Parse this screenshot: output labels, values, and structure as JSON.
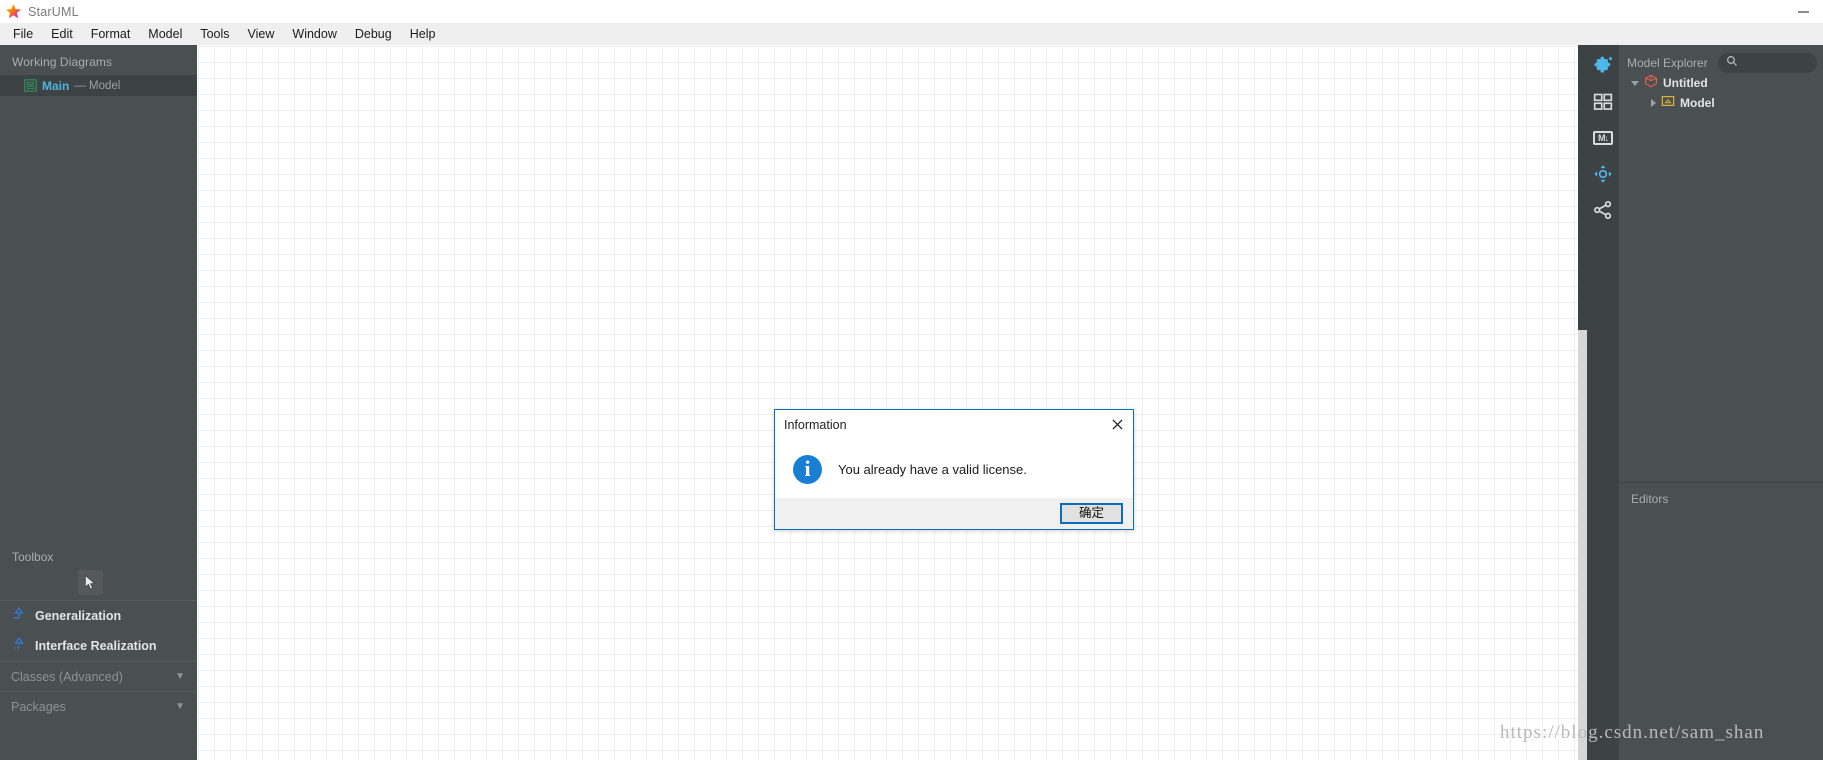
{
  "titlebar": {
    "app_title": "StarUML",
    "logo_icon": "star-icon",
    "minimize_label": "–"
  },
  "menubar": {
    "items": [
      {
        "label": "File"
      },
      {
        "label": "Edit"
      },
      {
        "label": "Format"
      },
      {
        "label": "Model"
      },
      {
        "label": "Tools"
      },
      {
        "label": "View"
      },
      {
        "label": "Window"
      },
      {
        "label": "Debug"
      },
      {
        "label": "Help"
      }
    ]
  },
  "left_panel": {
    "working_diagrams_header": "Working Diagrams",
    "diagram": {
      "icon": "class-diagram-icon",
      "name": "Main",
      "subtitle": "— Model"
    },
    "toolbox_header": "Toolbox",
    "cursor_tool": "cursor-tool",
    "tools": [
      {
        "label": "Generalization",
        "icon": "generalization-arrow-icon"
      },
      {
        "label": "Interface Realization",
        "icon": "interface-realization-icon"
      }
    ],
    "sections": [
      {
        "label": "Classes (Advanced)",
        "caret": "▼"
      },
      {
        "label": "Packages",
        "caret": "▼"
      }
    ]
  },
  "icon_strip": {
    "icons": [
      {
        "name": "extension-puzzle-icon"
      },
      {
        "name": "grid-layout-icon"
      },
      {
        "name": "markdown-icon",
        "glyph": "M↓"
      },
      {
        "name": "move-crosshair-icon"
      },
      {
        "name": "share-nodes-icon"
      }
    ]
  },
  "right_panel": {
    "model_explorer_title": "Model Explorer",
    "search": {
      "icon": "search-icon",
      "value": "",
      "placeholder": ""
    },
    "tree": [
      {
        "label": "Untitled",
        "icon": "project-cube-icon",
        "expander": "triangle-down",
        "level": 1
      },
      {
        "label": "Model",
        "icon": "model-folder-icon",
        "expander": "triangle-right",
        "level": 2
      }
    ],
    "editors_header": "Editors"
  },
  "dialog": {
    "title": "Information",
    "close_icon": "close-icon",
    "info_icon": "info-icon",
    "message": "You already have a valid license.",
    "ok_label": "确定"
  },
  "watermark": {
    "text": "https://blog.csdn.net/sam_shan"
  },
  "colors": {
    "panel_bg": "#4a4f52",
    "panel_dark": "#3d4245",
    "accent_blue": "#0b6ebd",
    "info_blue": "#1a7fd4",
    "diagram_link": "#4fb3d9",
    "menu_bg": "#efefef"
  }
}
